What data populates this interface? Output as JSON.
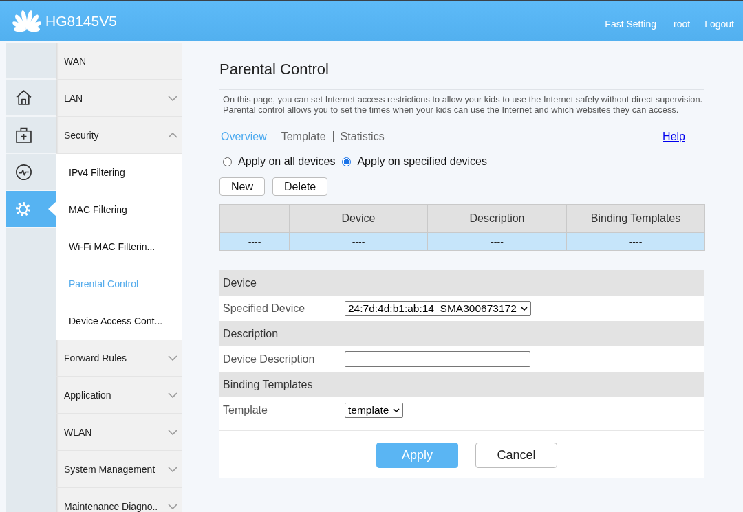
{
  "header": {
    "title": "HG8145V5",
    "links": [
      {
        "label": "Fast Setting",
        "kind": "action"
      },
      {
        "label": "root",
        "kind": "user"
      },
      {
        "label": "Logout",
        "kind": "action"
      }
    ]
  },
  "icon_bar": [
    {
      "kind": "home",
      "selected": false
    },
    {
      "kind": "medical",
      "selected": false
    },
    {
      "kind": "monitor",
      "selected": false
    },
    {
      "kind": "settings",
      "selected": true
    }
  ],
  "menu": [
    {
      "label": "WAN",
      "kind": "link"
    },
    {
      "label": "LAN",
      "kind": "group",
      "expanded": false
    },
    {
      "label": "Security",
      "kind": "group",
      "expanded": true,
      "children": [
        {
          "label": "IPv4 Filtering",
          "selected": false
        },
        {
          "label": "MAC Filtering",
          "selected": false
        },
        {
          "label": "Wi-Fi MAC Filterin...",
          "selected": false
        },
        {
          "label": "Parental Control",
          "selected": true
        },
        {
          "label": "Device Access Cont...",
          "selected": false
        }
      ]
    },
    {
      "label": "Forward Rules",
      "kind": "group",
      "expanded": false
    },
    {
      "label": "Application",
      "kind": "group",
      "expanded": false
    },
    {
      "label": "WLAN",
      "kind": "group",
      "expanded": false
    },
    {
      "label": "System Management",
      "kind": "group",
      "expanded": false
    },
    {
      "label": "Maintenance Diagno..",
      "kind": "group",
      "expanded": false
    }
  ],
  "page": {
    "title": "Parental Control",
    "intro": [
      "On this page, you can set Internet access restrictions to allow your kids to use the Internet safely without direct supervision.",
      "Parental control allows you to set the times when your kids can use the Internet and which websites they can access."
    ],
    "tabs": [
      {
        "label": "Overview",
        "selected": true
      },
      {
        "label": "Template",
        "selected": false
      },
      {
        "label": "Statistics",
        "selected": false
      }
    ],
    "help": "Help",
    "apply_scope": [
      {
        "label": "Apply on all devices",
        "selected": false
      },
      {
        "label": "Apply on specified devices",
        "selected": true
      }
    ],
    "list_buttons": [
      "New",
      "Delete"
    ],
    "table": {
      "columns": [
        "",
        "Device",
        "Description",
        "Binding Templates"
      ],
      "rows": [
        {
          "cells": [
            "----",
            "----",
            "----",
            "----"
          ],
          "selected": true
        }
      ]
    },
    "form": [
      {
        "title": "Device",
        "fields": [
          {
            "label": "Specified Device",
            "kind": "select",
            "value": "24:7d:4d:b1:ab:14  SMA300673172"
          }
        ]
      },
      {
        "title": "Description",
        "fields": [
          {
            "label": "Device Description",
            "kind": "text"
          }
        ]
      },
      {
        "title": "Binding Templates",
        "fields": [
          {
            "label": "Template",
            "kind": "select",
            "value": "template"
          }
        ]
      }
    ],
    "actions": [
      {
        "label": "Apply",
        "kind": "primary"
      },
      {
        "label": "Cancel",
        "kind": "secondary"
      }
    ]
  }
}
